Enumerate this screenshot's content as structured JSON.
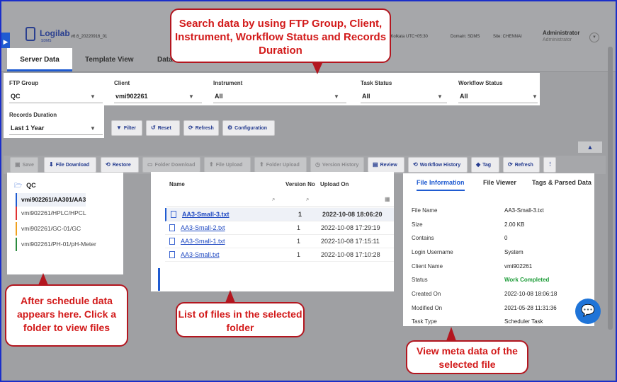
{
  "header": {
    "logo": "Logilab",
    "logo_sub": "SDMS",
    "version": "v6.6_20220916_01",
    "timezone": "Asia/Kolkata UTC+05:30",
    "domain": "Domain: SDMS",
    "site": "Site: CHENNAI",
    "user": "Administrator",
    "role": "Administrator"
  },
  "tabs": [
    {
      "label": "Server Data",
      "active": true
    },
    {
      "label": "Template View",
      "active": false
    },
    {
      "label": "Data",
      "active": false
    }
  ],
  "filters": {
    "ftp_group": {
      "label": "FTP Group",
      "value": "QC"
    },
    "client": {
      "label": "Client",
      "value": "vmi902261"
    },
    "instrument": {
      "label": "Instrument",
      "value": "All"
    },
    "task_status": {
      "label": "Task Status",
      "value": "All"
    },
    "workflow_status": {
      "label": "Workflow Status",
      "value": "All"
    },
    "records_duration": {
      "label": "Records Duration",
      "value": "Last 1 Year"
    }
  },
  "filter_buttons": {
    "filter": "Filter",
    "reset": "Reset",
    "refresh": "Refresh",
    "configuration": "Configuration"
  },
  "toolbar": {
    "save": "Save",
    "file_download": "File Download",
    "restore": "Restore",
    "folder_download": "Folder Download",
    "file_upload": "File Upload",
    "folder_upload": "Folder Upload",
    "version_history": "Version History",
    "review": "Review",
    "workflow_history": "Workflow History",
    "tag": "Tag",
    "refresh": "Refresh"
  },
  "folders": {
    "root": "QC",
    "items": [
      {
        "label": "vmi902261/AA301/AA3",
        "color": "#1f5bd1",
        "selected": true
      },
      {
        "label": "vmi902261/HPLC/HPCL",
        "color": "#e03131",
        "selected": false
      },
      {
        "label": "vmi902261/GC-01/GC",
        "color": "#f0a01e",
        "selected": false
      },
      {
        "label": "vmi902261/PH-01/pH-Meter",
        "color": "#2b8a3e",
        "selected": false
      }
    ]
  },
  "files": {
    "columns": [
      "Name",
      "Version No",
      "Upload On"
    ],
    "rows": [
      {
        "name": "AA3-Small-3.txt",
        "version": "1",
        "upload": "2022-10-08 18:06:20"
      },
      {
        "name": "AA3-Small-2.txt",
        "version": "1",
        "upload": "2022-10-08 17:29:19"
      },
      {
        "name": "AA3-Small-1.txt",
        "version": "1",
        "upload": "2022-10-08 17:15:11"
      },
      {
        "name": "AA3-Small.txt",
        "version": "1",
        "upload": "2022-10-08 17:10:28"
      }
    ]
  },
  "meta": {
    "tabs": [
      "File Information",
      "File Viewer",
      "Tags & Parsed Data"
    ],
    "fields": [
      {
        "key": "File Name",
        "value": "AA3-Small-3.txt"
      },
      {
        "key": "Size",
        "value": "2.00 KB"
      },
      {
        "key": "Contains",
        "value": "0"
      },
      {
        "key": "Login Username",
        "value": "System"
      },
      {
        "key": "Client Name",
        "value": "vmi902261"
      },
      {
        "key": "Status",
        "value": "Work Completed"
      },
      {
        "key": "Created On",
        "value": "2022-10-08 18:06:18"
      },
      {
        "key": "Modified On",
        "value": "2021-05-28 11:31:36"
      },
      {
        "key": "Task Type",
        "value": "Scheduler Task"
      }
    ]
  },
  "callouts": {
    "search": "Search data by using FTP Group, Client, Instrument, Workflow Status and Records Duration",
    "folders": "After schedule data appears here. Click a folder to view files",
    "files": "List of files in the selected folder",
    "meta": "View meta data of the selected file"
  },
  "colors": {
    "accent": "#1f5bd1",
    "callout_text": "#d21a1a",
    "callout_border": "#b3161f",
    "status_ok": "#1f9d3a"
  }
}
